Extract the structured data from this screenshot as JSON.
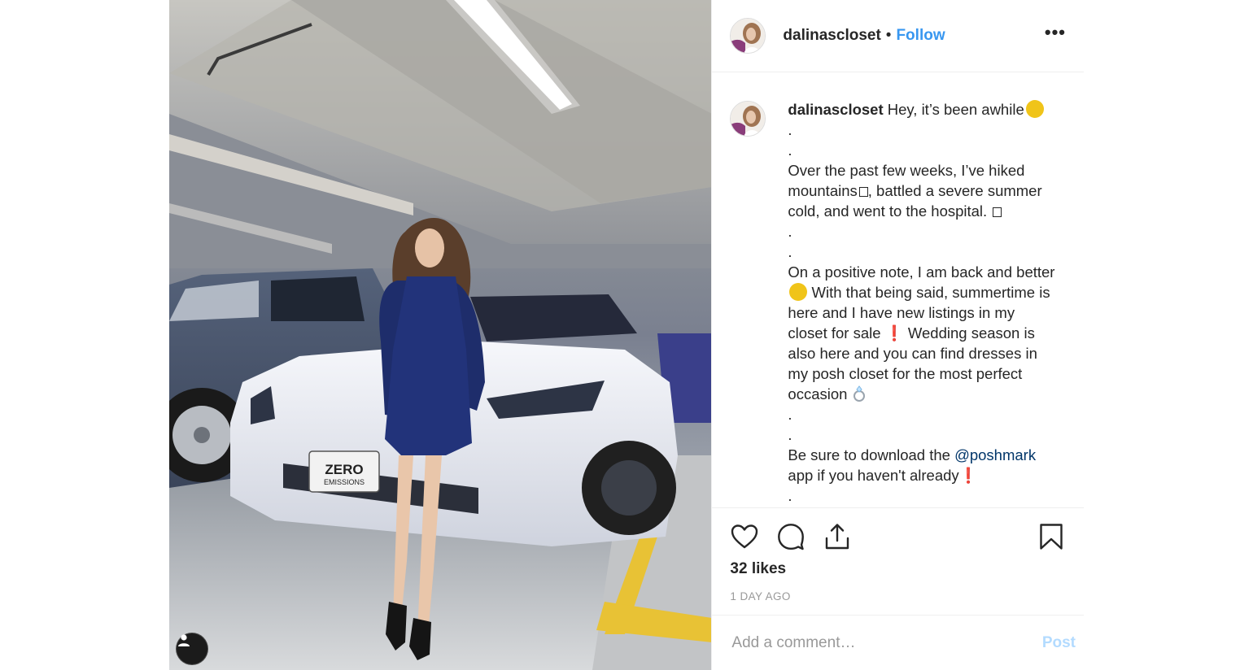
{
  "header": {
    "username": "dalinascloset",
    "separator": "•",
    "follow_label": "Follow",
    "more_label": "•••"
  },
  "photo": {
    "plate_line1": "ZERO",
    "plate_line2": "EMISSIONS",
    "user_tag_icon": "person-icon"
  },
  "caption": {
    "username": "dalinascloset",
    "line1": "Hey, it’s been awhile",
    "dot1": ".",
    "dot2": ".",
    "p1_l1": "Over the past few weeks, I’ve hiked",
    "p1_l2a": "mountains",
    "p1_l2b": ", battled a severe summer",
    "p1_l3": "cold, and went to the hospital.",
    "dot3": ".",
    "dot4": ".",
    "p2_l1": "On a positive note, I am back and better",
    "p2_l2": " With that being said, summertime is",
    "p2_l3": "here and I have new listings in my",
    "p2_l4a": "closet for sale",
    "p2_l4b": " Wedding season is",
    "p2_l5": "also here and you can find dresses in",
    "p2_l6": "my posh closet for the most perfect",
    "p2_l7": "occasion",
    "dot5": ".",
    "dot6": ".",
    "p3_l1a": "Be sure to download the ",
    "p3_mention": "@poshmark",
    "p3_l2": "app if you haven't already",
    "dot7": ".",
    "bang": "❗"
  },
  "actions": {
    "icons": [
      "heart-icon",
      "comment-icon",
      "share-icon",
      "bookmark-icon"
    ],
    "likes": "32 likes",
    "timestamp": "1 DAY AGO"
  },
  "comment_box": {
    "placeholder": "Add a comment…",
    "post_label": "Post"
  },
  "colors": {
    "follow": "#3897f0",
    "mention": "#003569",
    "post_disabled": "#b3dbff",
    "muted": "#999999",
    "border": "#efefef"
  }
}
